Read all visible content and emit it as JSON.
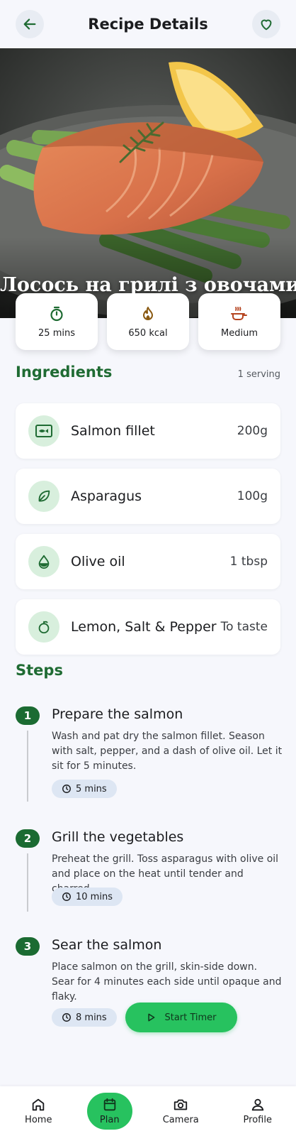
{
  "header": {
    "title": "Recipe Details",
    "back_icon": "arrow-left-icon",
    "favorite_icon": "heart-outline-icon"
  },
  "hero": {
    "title": "Лосось на грилі з овочами"
  },
  "stats": [
    {
      "label": "25 mins",
      "icon": "timer-icon"
    },
    {
      "label": "650 kcal",
      "icon": "flame-icon"
    },
    {
      "label": "Medium",
      "icon": "pot-icon"
    }
  ],
  "ingredients": {
    "title": "Ingredients",
    "servings": "1 serving",
    "items": [
      {
        "name": "Salmon fillet",
        "qty": "200g",
        "icon": "fish-icon"
      },
      {
        "name": "Asparagus",
        "qty": "100g",
        "icon": "leaf-icon"
      },
      {
        "name": "Olive oil",
        "qty": "1 tbsp",
        "icon": "oil-drop-icon"
      },
      {
        "name": "Lemon, Salt & Pepper",
        "qty": "To taste",
        "icon": "lemon-icon"
      }
    ]
  },
  "steps": {
    "title": "Steps",
    "items": [
      {
        "number": "1",
        "title": "Prepare the salmon",
        "description": "Wash and pat dry the salmon fillet. Season with salt, pepper, and a dash of olive oil. Let it sit for 5 minutes.",
        "time": "5 mins"
      },
      {
        "number": "2",
        "title": "Grill the vegetables",
        "description": "Preheat the grill. Toss asparagus with olive oil and place on the heat until tender and charred.",
        "time": "10 mins"
      },
      {
        "number": "3",
        "title": "Sear the salmon",
        "description": "Place salmon on the grill, skin-side down. Sear for 4 minutes each side until opaque and flaky.",
        "time": "8 mins",
        "button": "Start Timer"
      }
    ]
  },
  "nav": [
    {
      "label": "Home",
      "icon": "home-icon"
    },
    {
      "label": "Plan",
      "icon": "calendar-icon",
      "active": true
    },
    {
      "label": "Camera",
      "icon": "camera-icon"
    },
    {
      "label": "Profile",
      "icon": "person-icon"
    }
  ],
  "colors": {
    "primary": "#1f6b33",
    "accent": "#27c25f",
    "background": "#f6f7fc",
    "chip": "#dde6f3",
    "icon_bg": "#d8efdd"
  }
}
